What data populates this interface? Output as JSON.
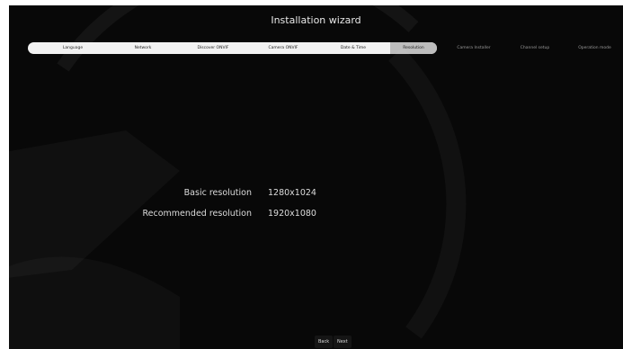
{
  "window": {
    "title": "Installation wizard"
  },
  "steps": [
    {
      "label": "Language"
    },
    {
      "label": "Network"
    },
    {
      "label": "Discover ONVIF"
    },
    {
      "label": "Camera ONVIF"
    },
    {
      "label": "Date & Time"
    },
    {
      "label": "Resolution"
    },
    {
      "label": "Camera Installer"
    },
    {
      "label": "Channel setup"
    },
    {
      "label": "Operation mode"
    }
  ],
  "resolution": {
    "basic_label": "Basic resolution",
    "basic_value": "1280x1024",
    "recommended_label": "Recommended resolution",
    "recommended_value": "1920x1080"
  },
  "buttons": {
    "back": "Back",
    "next": "Next"
  }
}
